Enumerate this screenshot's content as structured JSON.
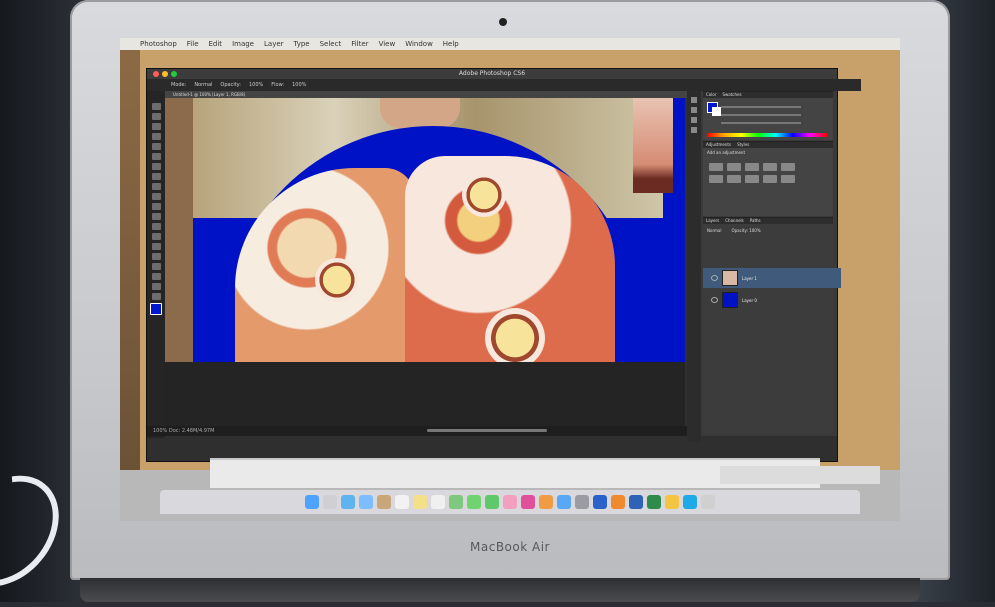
{
  "device": {
    "brand_label": "MacBook Air"
  },
  "menubar": {
    "app_name": "Photoshop",
    "items": [
      "File",
      "Edit",
      "Image",
      "Layer",
      "Type",
      "Select",
      "Filter",
      "View",
      "Window",
      "Help"
    ]
  },
  "photoshop": {
    "window_title": "Adobe Photoshop CS6",
    "doc_tab": "Untitled-1 @ 100% (Layer 1, RGB/8)",
    "options": [
      "Mode:",
      "Normal",
      "Opacity:",
      "100%",
      "Flow:",
      "100%"
    ],
    "status_text": "100%     Doc: 2.48M/4.97M",
    "panels": {
      "color_tabs": [
        "Color",
        "Swatches"
      ],
      "adjustments_tabs": [
        "Adjustments",
        "Styles"
      ],
      "adjustments_subtitle": "Add an adjustment",
      "layers_tabs": [
        "Layers",
        "Channels",
        "Paths"
      ],
      "layers_blend": "Normal",
      "layers_opacity": "Opacity: 100%",
      "layers": [
        {
          "name": "Layer 1",
          "selected": true,
          "thumb_color": "#d9b8a6"
        },
        {
          "name": "Layer 0",
          "selected": false,
          "thumb_color": "#0012c5"
        }
      ]
    }
  },
  "colors": {
    "foreground_swatch": "#0018cc",
    "ps_dark": "#2f2f2f",
    "selection_blue": "#3f5a7b"
  },
  "dock": {
    "icons": [
      "finder-icon",
      "launchpad-icon",
      "safari-icon",
      "mail-icon",
      "contacts-icon",
      "calendar-icon",
      "notes-icon",
      "reminders-icon",
      "maps-icon",
      "messages-icon",
      "facetime-icon",
      "photos-icon",
      "itunes-icon",
      "ibooks-icon",
      "appstore-icon",
      "preferences-icon",
      "photoshop-icon",
      "illustrator-icon",
      "word-icon",
      "excel-icon",
      "chrome-icon",
      "skype-icon",
      "trash-icon"
    ],
    "icon_colors": [
      "#4da3ff",
      "#cfcfd4",
      "#5fb4f0",
      "#7cbcff",
      "#c9a77a",
      "#f2f2f2",
      "#f5e08a",
      "#f0f0f0",
      "#7fc97f",
      "#6fd36f",
      "#5ec86a",
      "#f3a0c0",
      "#e0509b",
      "#f29b45",
      "#59a8f5",
      "#9b9ba3",
      "#2b62c9",
      "#f08a2e",
      "#2d62b6",
      "#2e8b4a",
      "#f4c542",
      "#1fa9e6",
      "#d0d0d0"
    ]
  }
}
